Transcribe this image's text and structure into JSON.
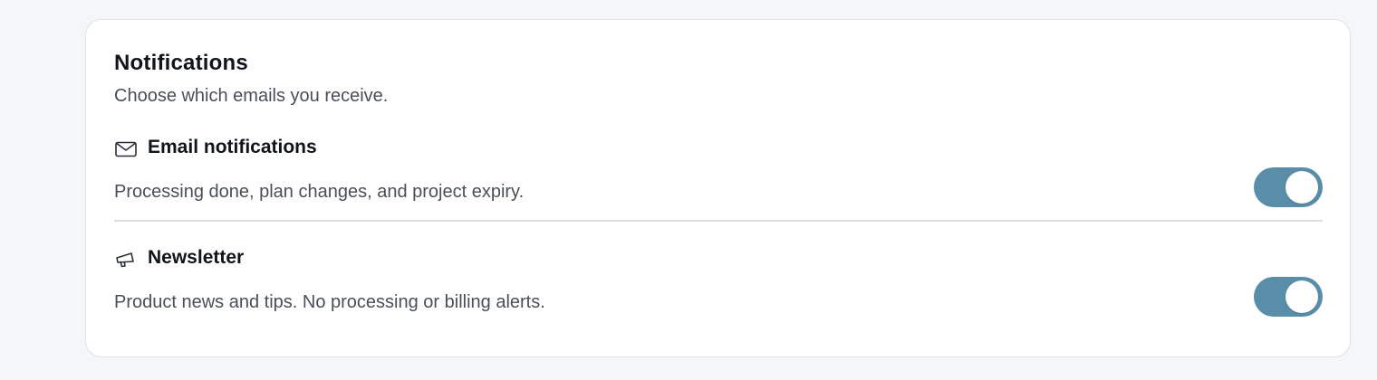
{
  "colors": {
    "toggle_on": "#5a8ea8",
    "page_background": "#f5f6f8",
    "card_background": "#ffffff"
  },
  "notifications": {
    "title": "Notifications",
    "subtitle": "Choose which emails you receive.",
    "items": [
      {
        "icon": "mail-icon",
        "title": "Email notifications",
        "description": "Processing done, plan changes, and project expiry.",
        "enabled": true
      },
      {
        "icon": "megaphone-icon",
        "title": "Newsletter",
        "description": "Product news and tips. No processing or billing alerts.",
        "enabled": true
      }
    ]
  }
}
